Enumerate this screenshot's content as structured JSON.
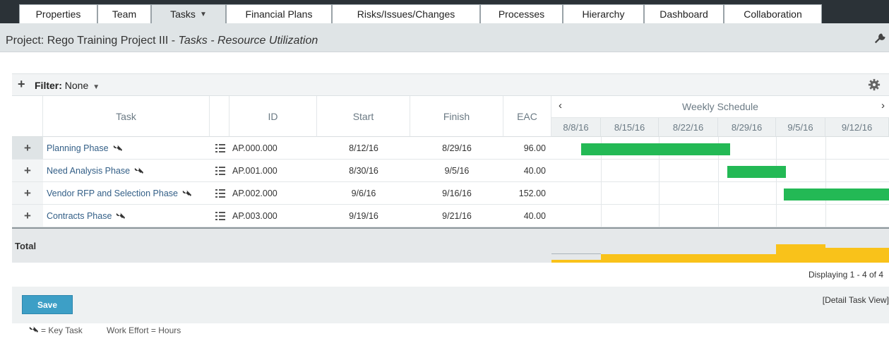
{
  "tabs": [
    {
      "label": "Properties"
    },
    {
      "label": "Team"
    },
    {
      "label": "Tasks",
      "active": true
    },
    {
      "label": "Financial Plans"
    },
    {
      "label": "Risks/Issues/Changes"
    },
    {
      "label": "Processes"
    },
    {
      "label": "Hierarchy"
    },
    {
      "label": "Dashboard"
    },
    {
      "label": "Collaboration"
    }
  ],
  "project": {
    "prefix": "Project: Rego Training Project III - ",
    "subtitle": "Tasks - Resource Utilization"
  },
  "filter": {
    "label": "Filter:",
    "value": "None"
  },
  "columns": {
    "task": "Task",
    "id": "ID",
    "start": "Start",
    "finish": "Finish",
    "eac": "EAC",
    "schedule": "Weekly Schedule"
  },
  "schedule_nav": {
    "prev": "‹",
    "next": "›"
  },
  "weeks": [
    "8/8/16",
    "8/15/16",
    "8/22/16",
    "8/29/16",
    "9/5/16",
    "9/12/16"
  ],
  "rows": [
    {
      "task": "Planning Phase",
      "id": "AP.000.000",
      "start": "8/12/16",
      "finish": "8/29/16",
      "eac": "96.00"
    },
    {
      "task": "Need Analysis Phase",
      "id": "AP.001.000",
      "start": "8/30/16",
      "finish": "9/5/16",
      "eac": "40.00"
    },
    {
      "task": "Vendor RFP and Selection Phase",
      "id": "AP.002.000",
      "start": "9/6/16",
      "finish": "9/16/16",
      "eac": "152.00"
    },
    {
      "task": "Contracts Phase",
      "id": "AP.003.000",
      "start": "9/19/16",
      "finish": "9/21/16",
      "eac": "40.00"
    }
  ],
  "total_label": "Total",
  "displaying": "Displaying 1 - 4 of 4",
  "save_label": "Save",
  "detail_link": "[Detail Task View]",
  "legend": {
    "key_task": "= Key Task",
    "work_effort": "Work Effort = Hours"
  },
  "colors": {
    "bar": "#23b955",
    "utilization": "#f9c21a",
    "save": "#3d9fc6"
  }
}
